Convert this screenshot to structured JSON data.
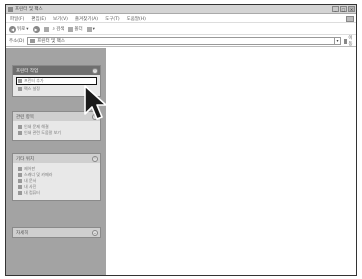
{
  "window": {
    "title": "프린터 및 팩스"
  },
  "title_buttons": [
    "_",
    "□",
    "×"
  ],
  "menubar": [
    "파일(F)",
    "편집(E)",
    "보기(V)",
    "즐겨찾기(A)",
    "도구(T)",
    "도움말(H)"
  ],
  "toolbar": {
    "back": "뒤로",
    "search": "검색",
    "folders": "폴더"
  },
  "address": {
    "label": "주소(D)",
    "value": "프린터 및 팩스",
    "go": "이동"
  },
  "panels": {
    "printer_tasks": {
      "header": "프린터 작업",
      "items": [
        "프린터 추가",
        "팩스 설정"
      ]
    },
    "see_also": {
      "header": "관련 항목",
      "items": [
        "인쇄 문제 해결",
        "인쇄 관련 도움말 보기"
      ]
    },
    "other_places": {
      "header": "기타 위치",
      "items": [
        "제어판",
        "스캐너 및 카메라",
        "내 문서",
        "내 사진",
        "내 컴퓨터"
      ]
    },
    "details": {
      "header": "자세히"
    }
  },
  "icons": {
    "title": "printer-icon",
    "back": "back-arrow-icon",
    "forward": "forward-arrow-icon",
    "up": "up-folder-icon",
    "search": "search-icon",
    "folders": "folders-icon",
    "views": "views-icon",
    "go": "go-arrow-icon",
    "cursor": "mouse-pointer-icon"
  }
}
